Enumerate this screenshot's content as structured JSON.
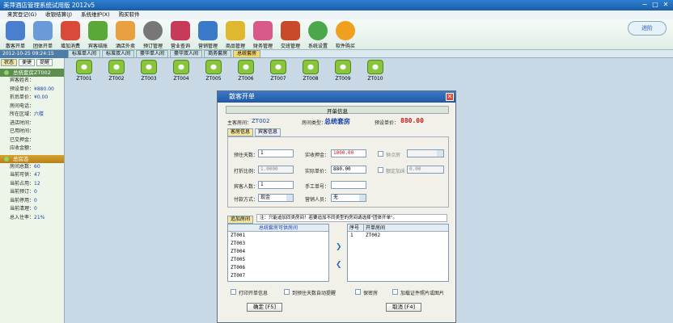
{
  "app": {
    "title": "美萍酒店管理系统试用版 2012v5"
  },
  "menu": [
    "来宾登记(G)",
    "收银结算(J)",
    "系统维护(X)",
    "购买软件"
  ],
  "toolbar": [
    "散客开单",
    "团体开单",
    "增加消费",
    "宾客结账",
    "酒店外卖",
    "预订管理",
    "营业查询",
    "营销管理",
    "商品管理",
    "财务管理",
    "交班管理",
    "系统设置",
    "软件购买"
  ],
  "brand": "进阶",
  "datetime": "2012-10-25 09:24:15",
  "room_tabs": [
    "标准单人间",
    "标准双人间",
    "豪华单人间",
    "豪华双人间",
    "商务套房",
    "总统套房"
  ],
  "sidebar": {
    "tabs": [
      "状态",
      "便捷",
      "提醒"
    ],
    "room_head": "总统套房ZT002",
    "room_lines": [
      [
        "宾客姓名：",
        ""
      ],
      [
        "预设单价：",
        "¥880.00"
      ],
      [
        "折后单价：",
        "¥0.00"
      ],
      [
        "房间电话：",
        ""
      ],
      [
        "所在区域：",
        "六楼"
      ],
      [
        "进店时间：",
        ""
      ],
      [
        "已用时间：",
        ""
      ],
      [
        "已交押金：",
        ""
      ],
      [
        "应收金额：",
        ""
      ]
    ],
    "stat_head": "总房态",
    "stat_lines": [
      [
        "房间总数：",
        "60"
      ],
      [
        "当前可供：",
        "47"
      ],
      [
        "当前占用：",
        "12"
      ],
      [
        "当前预订：",
        "0"
      ],
      [
        "当前停用：",
        "0"
      ],
      [
        "当前清理：",
        "0"
      ],
      [
        "总入住率：",
        "21%"
      ]
    ]
  },
  "rooms": [
    "ZT001",
    "ZT002",
    "ZT003",
    "ZT004",
    "ZT005",
    "ZT006",
    "ZT007",
    "ZT008",
    "ZT009",
    "ZT010"
  ],
  "dialog": {
    "title": "散客开单",
    "section": "开单信息",
    "main_room_label": "主客房间：",
    "main_room": "ZT002",
    "room_type_label": "房间类型：",
    "room_type": "总统套房",
    "preset_price_label": "预设单价：",
    "preset_price": "880.00",
    "tabs": [
      "客房信息",
      "宾客信息"
    ],
    "days_label": "预住天数：",
    "days": "1",
    "deposit_label": "实收押金：",
    "deposit": "1000.00",
    "hourly_label": "钟点房",
    "hourly_value": "",
    "discount_label": "打折比例：",
    "discount": "1.0000",
    "actual_price_label": "实际单价：",
    "actual_price": "880.00",
    "extra_bed_label": "额定加床",
    "extra_bed": "0.00",
    "guests_label": "宾客人数：",
    "guests": "1",
    "manual_no_label": "手工单号：",
    "manual_no": "",
    "pay_label": "付款方式：",
    "pay": "现金",
    "sales_label": "营销人员：",
    "sales": "无",
    "add_room_tab": "追加房间",
    "note": "注：只能追加同类房间！若要追加不同类型的房间请选择\"团体开单\"。",
    "available_head": "总统套房可供房间",
    "available": [
      "ZT001",
      "ZT003",
      "ZT004",
      "ZT005",
      "ZT006",
      "ZT007"
    ],
    "col_no": "序号",
    "col_room": "开单房间",
    "selected_row": [
      "1",
      "ZT002"
    ],
    "cb_print": "打印开单信息",
    "cb_remind": "到预住天数自动提醒",
    "cb_secret": "保密房",
    "cb_photo": "加载证件照片或图片",
    "ok": "确定 [F5]",
    "cancel": "取消 [F4]"
  }
}
